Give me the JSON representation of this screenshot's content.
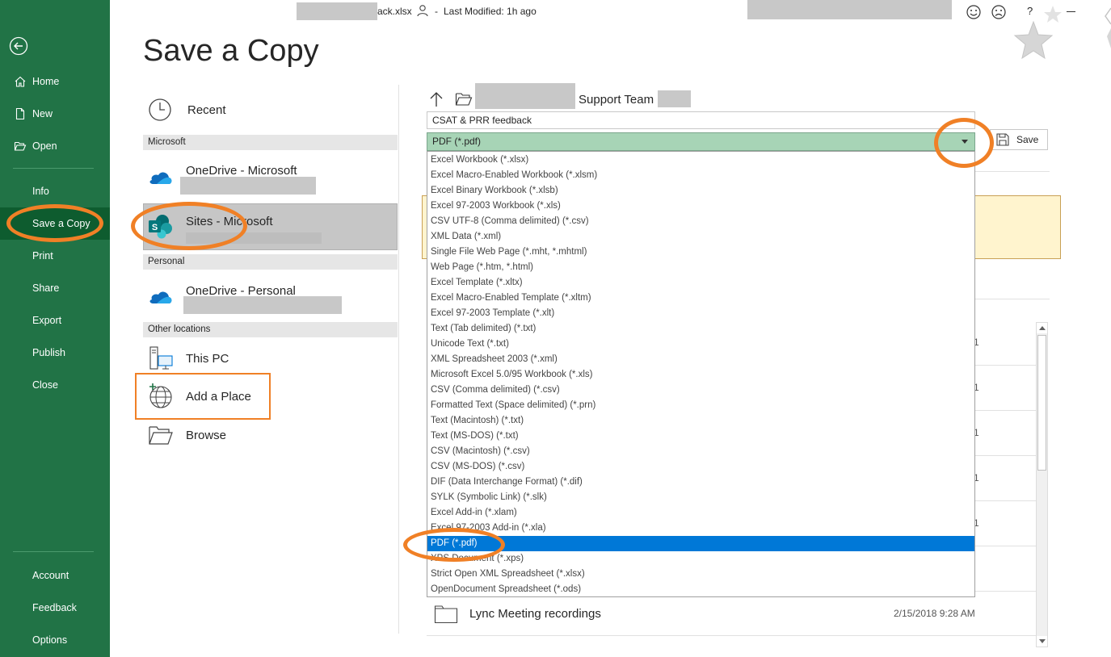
{
  "titlebar": {
    "filename_suffix": "ack.xlsx",
    "last_modified": "Last Modified: 1h ago",
    "help": "?"
  },
  "nav": {
    "items": [
      {
        "label": "Home",
        "icon": "home-icon"
      },
      {
        "label": "New",
        "icon": "new-document-icon"
      },
      {
        "label": "Open",
        "icon": "open-folder-icon"
      },
      {
        "label": "Info"
      },
      {
        "label": "Save a Copy"
      },
      {
        "label": "Print"
      },
      {
        "label": "Share"
      },
      {
        "label": "Export"
      },
      {
        "label": "Publish"
      },
      {
        "label": "Close"
      },
      {
        "label": "Account"
      },
      {
        "label": "Feedback"
      },
      {
        "label": "Options"
      }
    ]
  },
  "page": {
    "title": "Save a Copy"
  },
  "locations": {
    "recent": "Recent",
    "section_microsoft": "Microsoft",
    "onedrive_ms": "OneDrive - Microsoft",
    "sites_ms": "Sites - Microsoft",
    "section_personal": "Personal",
    "onedrive_personal": "OneDrive - Personal",
    "section_other": "Other locations",
    "this_pc": "This PC",
    "add_place": "Add a Place",
    "browse": "Browse"
  },
  "path": {
    "folder": "Support Team"
  },
  "filename": {
    "value": "CSAT & PRR feedback"
  },
  "filetype": {
    "selected": "PDF (*.pdf)",
    "options": [
      "Excel Workbook (*.xlsx)",
      "Excel Macro-Enabled Workbook (*.xlsm)",
      "Excel Binary Workbook (*.xlsb)",
      "Excel 97-2003 Workbook (*.xls)",
      "CSV UTF-8 (Comma delimited) (*.csv)",
      "XML Data (*.xml)",
      "Single File Web Page (*.mht, *.mhtml)",
      "Web Page (*.htm, *.html)",
      "Excel Template (*.xltx)",
      "Excel Macro-Enabled Template (*.xltm)",
      "Excel 97-2003 Template (*.xlt)",
      "Text (Tab delimited) (*.txt)",
      "Unicode Text (*.txt)",
      "XML Spreadsheet 2003 (*.xml)",
      "Microsoft Excel 5.0/95 Workbook (*.xls)",
      "CSV (Comma delimited) (*.csv)",
      "Formatted Text (Space delimited) (*.prn)",
      "Text (Macintosh) (*.txt)",
      "Text (MS-DOS) (*.txt)",
      "CSV (Macintosh) (*.csv)",
      "CSV (MS-DOS) (*.csv)",
      "DIF (Data Interchange Format) (*.dif)",
      "SYLK (Symbolic Link) (*.slk)",
      "Excel Add-in (*.xlam)",
      "Excel 97-2003 Add-in (*.xla)",
      "PDF (*.pdf)",
      "XPS Document (*.xps)",
      "Strict Open XML Spreadsheet (*.xlsx)",
      "OpenDocument Spreadsheet (*.ods)"
    ],
    "selected_index": 25
  },
  "save_button": {
    "label": "Save"
  },
  "folder_list": {
    "row_marks": [
      "1",
      "1",
      "1",
      "1",
      "1"
    ],
    "last_folder": {
      "name": "Lync Meeting recordings",
      "date": "2/15/2018 9:28 AM"
    }
  },
  "colors": {
    "nav_bg": "#217346",
    "nav_active": "#0e5c2f",
    "annotation": "#f08026",
    "selection": "#0078d7",
    "filetype_bg": "#a7d4b6"
  }
}
